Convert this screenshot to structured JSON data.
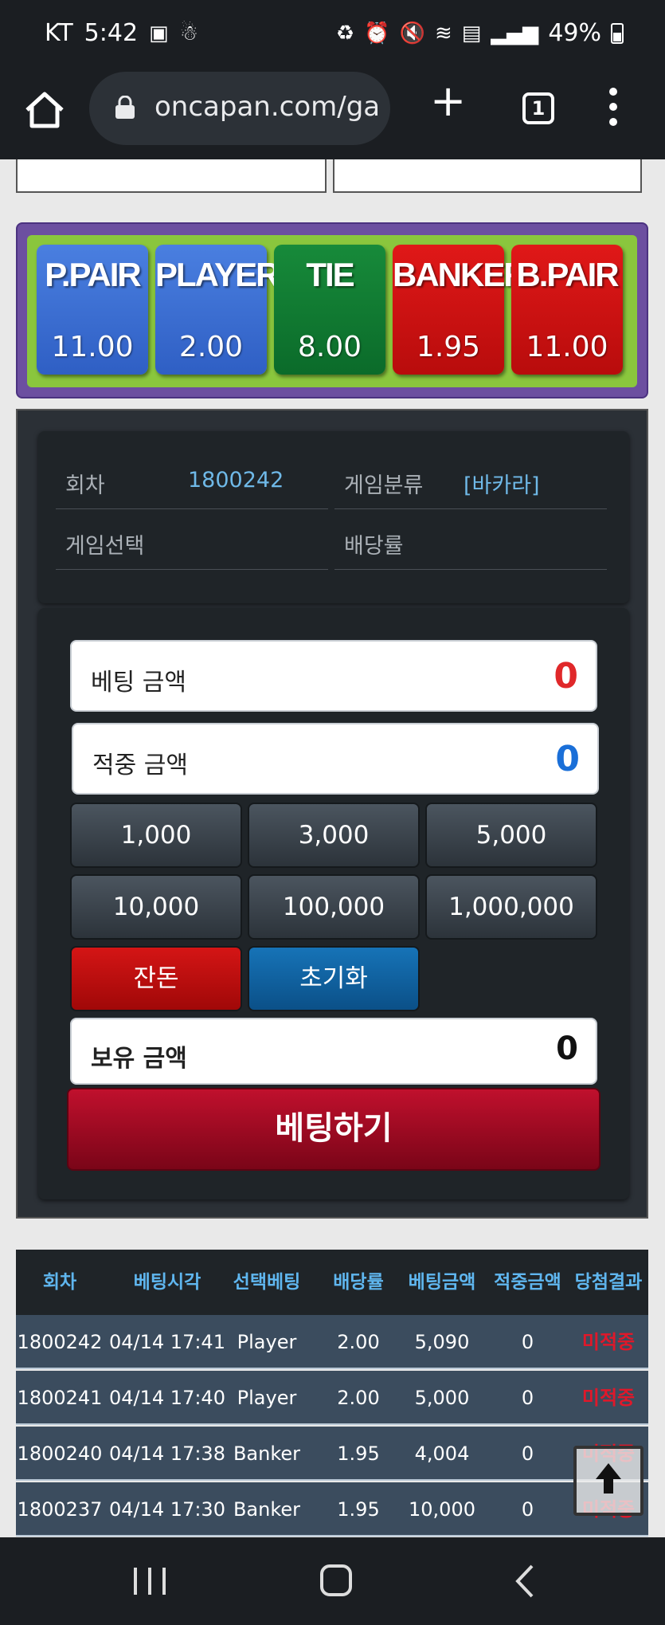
{
  "status_bar": {
    "carrier": "KT",
    "time": "5:42",
    "battery": "49%"
  },
  "browser": {
    "url": "oncapan.com/ga",
    "tab_count": "1"
  },
  "odds": [
    {
      "label": "P.PAIR",
      "value": "11.00",
      "color": "#2f5fc4"
    },
    {
      "label": "PLAYER",
      "value": "2.00",
      "color": "#2f5fc4"
    },
    {
      "label": "TIE",
      "value": "8.00",
      "color": "#0b6b2a"
    },
    {
      "label": "BANKER",
      "value": "1.95",
      "color": "#b80c0c"
    },
    {
      "label": "B.PAIR",
      "value": "11.00",
      "color": "#b80c0c"
    }
  ],
  "info": {
    "round_label": "회차",
    "round_value": "1800242",
    "category_label": "게임분류",
    "category_value": "[바카라]",
    "selection_label": "게임선택",
    "rate_label": "배당률"
  },
  "bet": {
    "bet_amount_label": "베팅 금액",
    "bet_amount_value": "0",
    "win_amount_label": "적중 금액",
    "win_amount_value": "0",
    "chips": [
      "1,000",
      "3,000",
      "5,000",
      "10,000",
      "100,000",
      "1,000,000"
    ],
    "change_label": "잔돈",
    "reset_label": "초기화",
    "balance_label": "보유 금액",
    "balance_value": "0",
    "submit_label": "베팅하기"
  },
  "history": {
    "columns": [
      "회차",
      "베팅시각",
      "선택베팅",
      "배당률",
      "베팅금액",
      "적중금액",
      "당첨결과"
    ],
    "rows": [
      [
        "1800242",
        "04/14 17:41",
        "Player",
        "2.00",
        "5,090",
        "0",
        "미적중"
      ],
      [
        "1800241",
        "04/14 17:40",
        "Player",
        "2.00",
        "5,000",
        "0",
        "미적중"
      ],
      [
        "1800240",
        "04/14 17:38",
        "Banker",
        "1.95",
        "4,004",
        "0",
        "미적중"
      ],
      [
        "1800237",
        "04/14 17:30",
        "Banker",
        "1.95",
        "10,000",
        "0",
        "미적중"
      ]
    ]
  }
}
